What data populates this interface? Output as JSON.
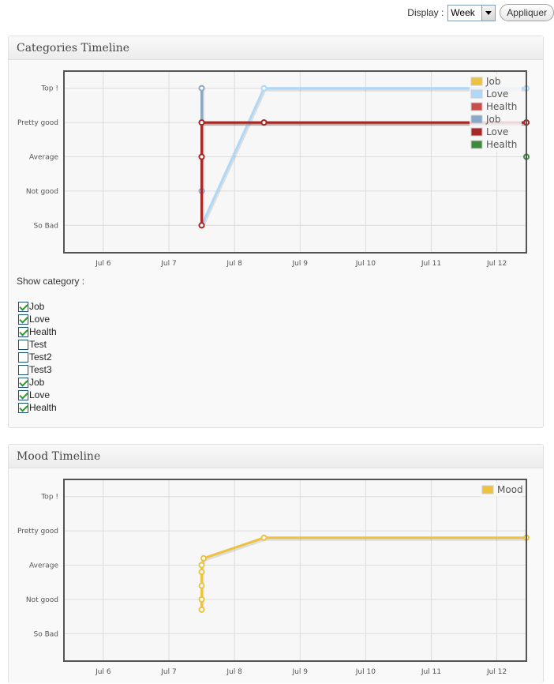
{
  "toolbar": {
    "display_label": "Display :",
    "display_value": "Week",
    "apply_label": "Appliquer"
  },
  "categories_panel": {
    "title": "Categories Timeline",
    "show_category_label": "Show category :",
    "categories": [
      {
        "label": "Job",
        "checked": true
      },
      {
        "label": "Love",
        "checked": true
      },
      {
        "label": "Health",
        "checked": true
      },
      {
        "label": "Test",
        "checked": false
      },
      {
        "label": "Test2",
        "checked": false
      },
      {
        "label": "Test3",
        "checked": false
      },
      {
        "label": "Job",
        "checked": true
      },
      {
        "label": "Love",
        "checked": true
      },
      {
        "label": "Health",
        "checked": true
      }
    ]
  },
  "mood_panel": {
    "title": "Mood Timeline"
  },
  "chart_data": [
    {
      "type": "line",
      "title": "",
      "x_ticks": [
        "Jul 6",
        "Jul 7",
        "Jul 8",
        "Jul 9",
        "Jul 10",
        "Jul 11",
        "Jul 12"
      ],
      "y_levels": [
        "So Bad",
        "Not good",
        "Average",
        "Pretty good",
        "Top !"
      ],
      "xlim": [
        5.4,
        12.45
      ],
      "ylim": [
        0.2,
        5.5
      ],
      "grid": true,
      "legend_position": "top-right",
      "series": [
        {
          "name": "Job",
          "color": "#edc240",
          "x": [
            7.5,
            7.5,
            8.45,
            12.45
          ],
          "y": [
            5,
            4,
            4,
            4
          ]
        },
        {
          "name": "Love",
          "color": "#afd8f8",
          "x": [
            7.5,
            8.45,
            12.45
          ],
          "y": [
            1,
            5,
            5
          ]
        },
        {
          "name": "Health",
          "color": "#cb4b4b",
          "x": [
            7.5,
            7.5,
            7.5,
            8.45,
            12.45
          ],
          "y": [
            1,
            3,
            4,
            4,
            4
          ]
        },
        {
          "name": "Job",
          "color": "#8aa8c8",
          "x": [
            7.5,
            7.5
          ],
          "y": [
            5,
            2
          ]
        },
        {
          "name": "Love",
          "color": "#a82828",
          "x": [
            7.5,
            7.5,
            7.5,
            8.45,
            12.45
          ],
          "y": [
            1,
            3,
            4,
            4,
            4
          ]
        },
        {
          "name": "Health",
          "color": "#3d8a3d",
          "x": [
            12.45
          ],
          "y": [
            3
          ]
        }
      ]
    },
    {
      "type": "line",
      "title": "",
      "x_ticks": [
        "Jul 6",
        "Jul 7",
        "Jul 8",
        "Jul 9",
        "Jul 10",
        "Jul 11",
        "Jul 12"
      ],
      "y_levels": [
        "So Bad",
        "Not good",
        "Average",
        "Pretty good",
        "Top !"
      ],
      "xlim": [
        5.4,
        12.45
      ],
      "ylim": [
        0.2,
        5.5
      ],
      "grid": true,
      "legend_position": "top-right",
      "series": [
        {
          "name": "Mood",
          "color": "#edc240",
          "x": [
            7.5,
            7.5,
            7.5,
            7.5,
            7.5,
            7.53,
            8.45,
            12.45
          ],
          "y": [
            1.7,
            2,
            2.4,
            2.8,
            3,
            3.2,
            3.8,
            3.8
          ]
        }
      ]
    }
  ]
}
